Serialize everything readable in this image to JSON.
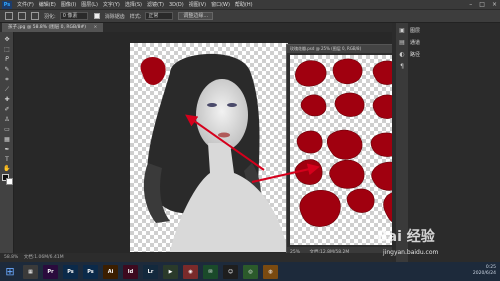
{
  "app": {
    "logo": "Ps"
  },
  "menu": [
    "文件(F)",
    "编辑(E)",
    "图像(I)",
    "图层(L)",
    "文字(Y)",
    "选择(S)",
    "滤镜(T)",
    "3D(D)",
    "视图(V)",
    "窗口(W)",
    "帮助(H)"
  ],
  "window_controls": {
    "minimize": "–",
    "maximize": "□",
    "close": "×"
  },
  "options": {
    "feather_label": "羽化:",
    "feather_value": "0 像素",
    "antialias_label": "消除锯齿",
    "style_label": "样式:",
    "style_value": "正常",
    "refine_edge_label": "调整边缘..."
  },
  "document": {
    "tab_label": "孩子.jpg @ 58.8% (图层 0, RGB/8#)",
    "close": "×",
    "zoom": "58.8%",
    "doc_info": "文档:1.06M/6.41M"
  },
  "second_document": {
    "title": "玫瑰花瓣.psd @ 25% (图层 0, RGB/8)",
    "zoom": "25%",
    "doc_info": "文档:12.8M/58.2M"
  },
  "right_panel": {
    "labels": [
      "图层",
      "通道",
      "路径"
    ]
  },
  "taskbar": {
    "apps": [
      {
        "name": "Pr",
        "color": "#2a0b3d"
      },
      {
        "name": "Ps",
        "color": "#0b2a4a"
      },
      {
        "name": "Ps",
        "color": "#0b2a4a"
      },
      {
        "name": "Ai",
        "color": "#3b1e00"
      },
      {
        "name": "Id",
        "color": "#3d0a1f"
      },
      {
        "name": "Lr",
        "color": "#13293d"
      }
    ],
    "time": "0:25",
    "date": "2020/6/24"
  },
  "watermark": {
    "brand": "Bai 经验",
    "url": "jingyan.baidu.com"
  },
  "colors": {
    "accent": "#31a8ff",
    "petal": "#a0000f"
  }
}
